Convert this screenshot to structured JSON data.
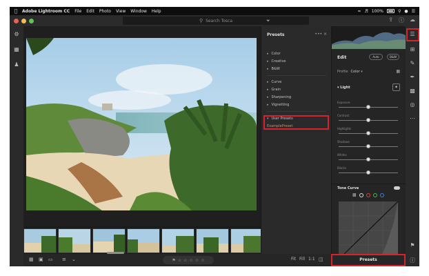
{
  "menubar": {
    "apple_icon": "apple-icon",
    "app_name": "Adobe Lightroom CC",
    "items": [
      "File",
      "Edit",
      "Photo",
      "View",
      "Window",
      "Help"
    ],
    "battery": "100%"
  },
  "toolbar": {
    "search_placeholder": "Search Tosca"
  },
  "presets_panel": {
    "title": "Presets",
    "more": "•••",
    "close": "×",
    "groups_a": [
      "Color",
      "Creative",
      "B&W"
    ],
    "groups_b": [
      "Curve",
      "Grain",
      "Sharpening",
      "Vignetting"
    ],
    "user_group": "User Presets",
    "user_item": "ExamplePreset"
  },
  "edit_panel": {
    "title": "Edit",
    "btn_auto": "Auto",
    "btn_bw": "B&W",
    "profile_label": "Profile",
    "profile_value": "Color",
    "light_section": "Light",
    "sliders": [
      {
        "label": "Exposure",
        "value": 0.5
      },
      {
        "label": "Contrast",
        "value": 0.5
      },
      {
        "label": "Highlights",
        "value": 0.5
      },
      {
        "label": "Shadows",
        "value": 0.5
      },
      {
        "label": "Whites",
        "value": 0.5
      },
      {
        "label": "Blacks",
        "value": 0.5
      }
    ],
    "tone_curve": "Tone Curve",
    "presets_button": "Presets"
  },
  "bottombar": {
    "fit": "Fit",
    "fill": "Fill",
    "ratio": "1:1"
  },
  "colors": {
    "highlight_red": "#d9232b",
    "panel_bg": "#252525",
    "app_bg": "#1e1e1e"
  }
}
